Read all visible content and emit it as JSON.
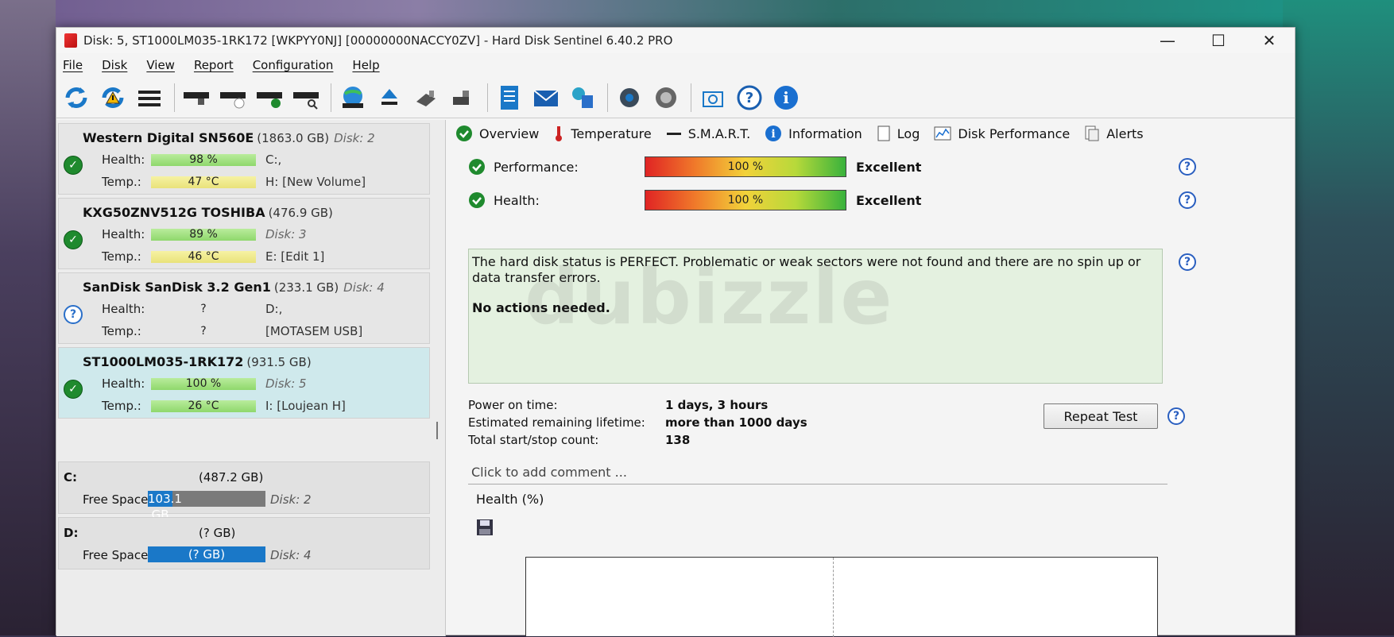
{
  "window": {
    "title": "Disk: 5, ST1000LM035-1RK172 [WKPYY0NJ]  [00000000NACCY0ZV] - Hard Disk Sentinel 6.40.2 PRO"
  },
  "menu": [
    "File",
    "Disk",
    "View",
    "Report",
    "Configuration",
    "Help"
  ],
  "toolbar_icons": [
    "refresh-icon",
    "refresh-warning-icon",
    "disk-list-icon",
    "disk-icon",
    "disk-clock-icon",
    "disk-check-icon",
    "disk-search-icon",
    "globe-disk-icon",
    "eject-icon",
    "usb-icon",
    "usb-alt-icon",
    "report-icon",
    "mail-icon",
    "network-icon",
    "settings-gear-icon",
    "speaker-icon",
    "camera-icon",
    "help-icon",
    "info-icon"
  ],
  "disks": [
    {
      "name": "Western Digital SN560E",
      "size": "(1863.0 GB)",
      "disk_no": "Disk: 2",
      "health_label": "Health:",
      "health": "98 %",
      "health_bar": "green",
      "temp_label": "Temp.:",
      "temp": "47 °C",
      "temp_bar": "yellow",
      "side1": "C:,",
      "side1_italic": false,
      "side2": "H: [New Volume]",
      "status": "ok"
    },
    {
      "name": "KXG50ZNV512G TOSHIBA",
      "size": "(476.9 GB)",
      "disk_no": "",
      "health_label": "Health:",
      "health": "89 %",
      "health_bar": "green",
      "temp_label": "Temp.:",
      "temp": "46 °C",
      "temp_bar": "yellow",
      "side1": "Disk: 3",
      "side1_italic": true,
      "side2": "E: [Edit 1]",
      "status": "ok"
    },
    {
      "name": "SanDisk SanDisk 3.2 Gen1",
      "size": "(233.1 GB)",
      "disk_no": "Disk: 4",
      "health_label": "Health:",
      "health": "?",
      "health_bar": "none",
      "temp_label": "Temp.:",
      "temp": "?",
      "temp_bar": "none",
      "side1": "D:,",
      "side1_italic": false,
      "side2": "[MOTASEM USB]",
      "status": "unknown"
    },
    {
      "name": "ST1000LM035-1RK172",
      "size": "(931.5 GB)",
      "disk_no": "",
      "health_label": "Health:",
      "health": "100 %",
      "health_bar": "green",
      "temp_label": "Temp.:",
      "temp": "26 °C",
      "temp_bar": "green",
      "side1": "Disk: 5",
      "side1_italic": true,
      "side2": "I: [Loujean H]",
      "status": "ok",
      "selected": true
    }
  ],
  "volumes": [
    {
      "letter": "C:",
      "size": "(487.2 GB)",
      "free_label": "Free Space",
      "free": "103.1 GB",
      "free_fraction": 0.21,
      "disk": "Disk: 2"
    },
    {
      "letter": "D:",
      "size": "(? GB)",
      "free_label": "Free Space",
      "free": "(? GB)",
      "free_fraction": 1.0,
      "disk": "Disk: 4"
    }
  ],
  "tabs": [
    {
      "label": "Overview",
      "icon": "check-circle-icon"
    },
    {
      "label": "Temperature",
      "icon": "thermometer-icon"
    },
    {
      "label": "S.M.A.R.T.",
      "icon": "smart-icon"
    },
    {
      "label": "Information",
      "icon": "info-icon"
    },
    {
      "label": "Log",
      "icon": "log-icon"
    },
    {
      "label": "Disk Performance",
      "icon": "chart-icon"
    },
    {
      "label": "Alerts",
      "icon": "alerts-icon"
    }
  ],
  "overview": {
    "performance_label": "Performance:",
    "performance_value": "100 %",
    "performance_text": "Excellent",
    "health_label": "Health:",
    "health_value": "100 %",
    "health_text": "Excellent",
    "status_message": "The hard disk status is PERFECT. Problematic or weak sectors were not found and there are no spin up or data transfer errors.",
    "actions": "No actions needed.",
    "watermark": "dubizzle",
    "power_on_label": "Power on time:",
    "power_on_value": "1 days, 3 hours",
    "lifetime_label": "Estimated remaining lifetime:",
    "lifetime_value": "more than 1000 days",
    "startstop_label": "Total start/stop count:",
    "startstop_value": "138",
    "repeat_button": "Repeat Test",
    "comment_placeholder": "Click to add comment ...",
    "chart_title": "Health (%)"
  },
  "colors": {
    "ok_green": "#1f8a2e",
    "accent_blue": "#2a5fc0",
    "selected_bg": "#cfe9ec",
    "volume_bar": "#1a78c8"
  }
}
